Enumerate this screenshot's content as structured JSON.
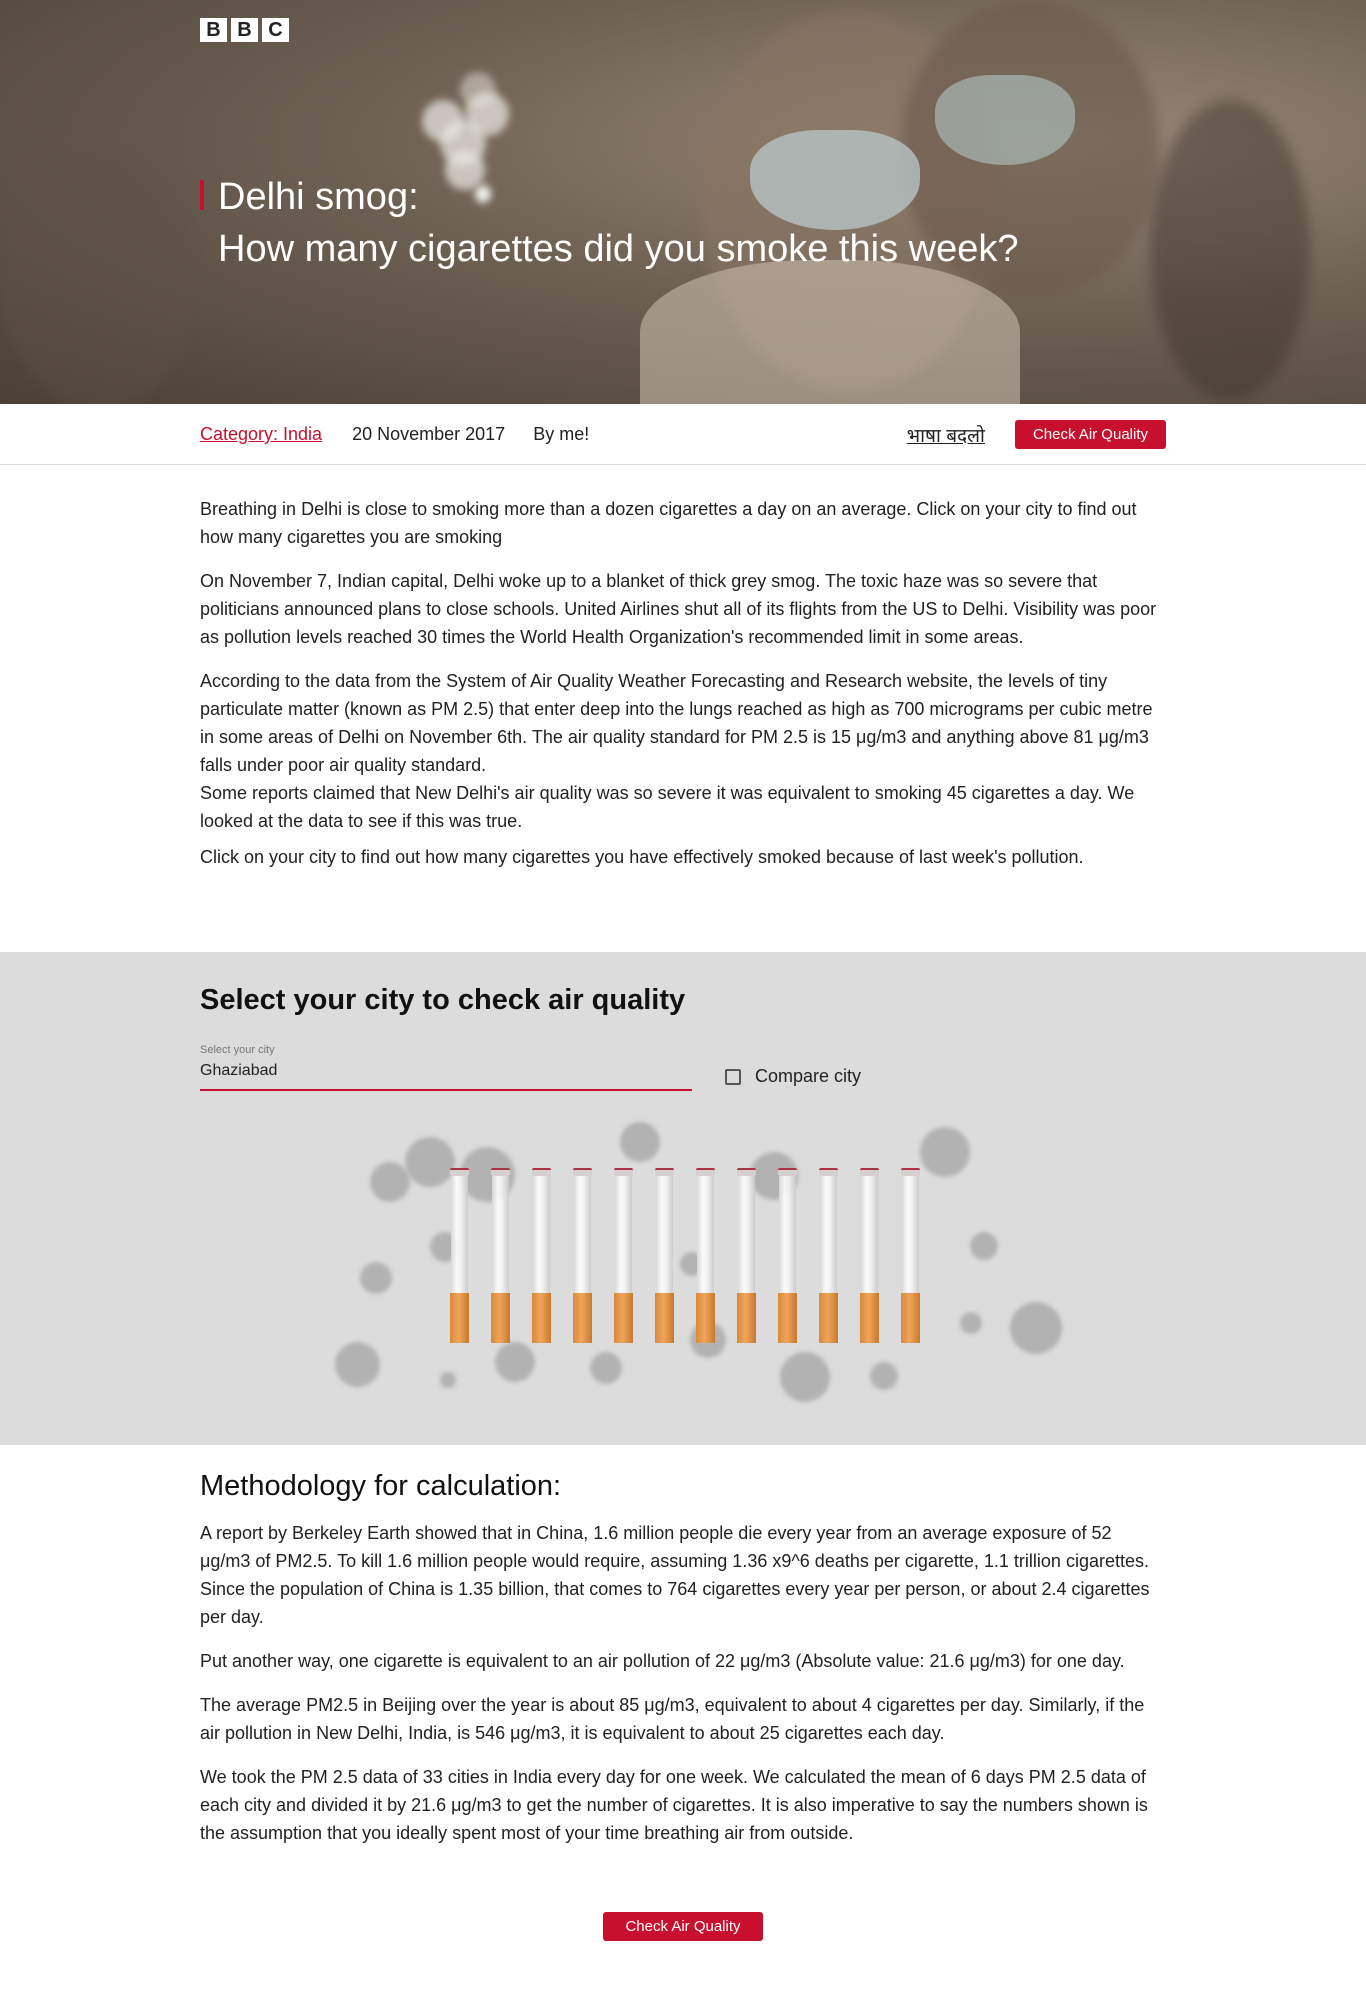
{
  "header": {
    "logo_letters": [
      "B",
      "B",
      "C"
    ],
    "title_line1": "Delhi smog:",
    "title_line2": "How many cigarettes did you smoke this week?"
  },
  "meta": {
    "category": "Category: India",
    "date": "20 November 2017",
    "author": "By me!",
    "language_link": "भाषा बदलो",
    "check_button": "Check Air Quality"
  },
  "article": {
    "paragraphs": [
      "Breathing in Delhi is close to smoking more than a dozen cigarettes a day on an average. Click on your city to find out how many cigarettes you are smoking",
      "On November 7, Indian capital, Delhi woke up to a blanket of thick grey smog.  The toxic haze was so severe that politicians announced plans to close schools.  United Airlines shut all of its flights from the US to Delhi. Visibility was poor as pollution levels reached 30 times the World Health Organization's recommended limit in some areas.",
      "According to the data from the System of Air Quality Weather Forecasting and Research website, the levels of tiny particulate matter (known as PM 2.5) that enter deep into the lungs reached as high as 700 micrograms per cubic metre in some areas of Delhi on November 6th. The air quality standard for PM 2.5 is 15 μg/m3 and anything above 81 μg/m3 falls under poor air quality standard.",
      "Some reports claimed that New Delhi's air quality was so severe it was equivalent to smoking 45 cigarettes a day. We looked at the data to see if this was true.",
      "Click on your city to find out how many cigarettes you have effectively smoked because of last week's pollution."
    ]
  },
  "city_section": {
    "heading": "Select your city to check air quality",
    "select_label": "Select your city",
    "select_value": "Ghaziabad",
    "compare_label": "Compare city",
    "cigarette_count": 12
  },
  "methodology": {
    "heading": "Methodology for calculation:",
    "paragraphs": [
      "A report by Berkeley Earth showed that in China, 1.6 million people die every year from an average exposure of 52 μg/m3 of PM2.5. To kill 1.6 million people would require, assuming 1.36 x9^6 deaths per cigarette, 1.1 trillion cigarettes. Since the population of China is 1.35 billion, that comes to 764 cigarettes every year per person, or about 2.4 cigarettes per day.",
      "Put another way, one cigarette is equivalent to an air pollution of 22 μg/m3 (Absolute value: 21.6 μg/m3) for one day.",
      "The average PM2.5 in Beijing over the year is about 85 μg/m3, equivalent to about 4 cigarettes per day. Similarly, if the air pollution in New Delhi, India, is 546 μg/m3, it is equivalent to about 25 cigarettes each day.",
      "We took the PM 2.5 data of 33 cities in India every day for one week. We calculated the mean of 6 days PM 2.5 data of each city and divided it by 21.6 μg/m3 to get the number of cigarettes. It is also imperative to say the numbers shown is the assumption that you ideally spent most of your time breathing air from outside."
    ],
    "bottom_button": "Check Air Quality"
  },
  "colors": {
    "accent": "#c8102e",
    "grey_section": "#dcdcdc"
  }
}
